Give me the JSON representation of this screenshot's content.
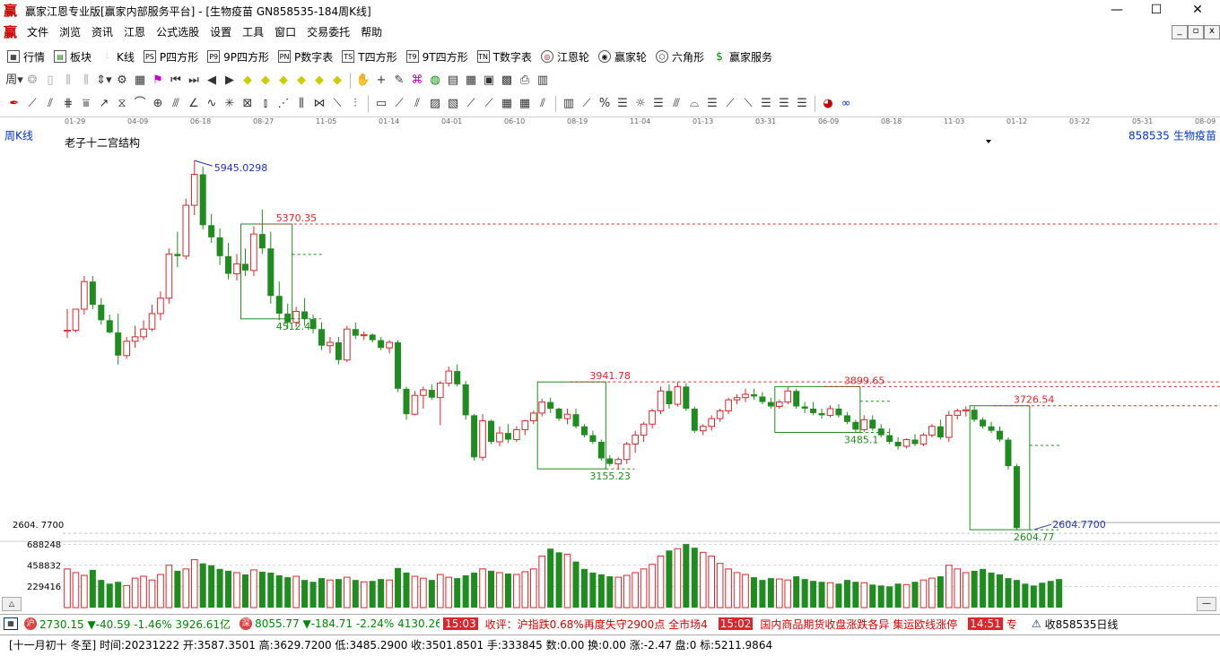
{
  "window": {
    "title": "赢家江恩专业版[赢家内部服务平台] - [生物疫苗   GN858535-184周K线]",
    "minimize_label": "—",
    "maximize_label": "☐",
    "close_label": "✕"
  },
  "app_logo": "赢",
  "menu": [
    "文件",
    "浏览",
    "资讯",
    "江恩",
    "公式选股",
    "设置",
    "工具",
    "窗口",
    "交易委托",
    "帮助"
  ],
  "toolbar_main": [
    {
      "label": "行情",
      "icon": "grid-icon"
    },
    {
      "label": "板块",
      "icon": "blocks-icon"
    },
    {
      "label": "K线",
      "icon": "kline-icon"
    },
    {
      "label": "P四方形",
      "icon": "ps-icon",
      "badge": "PS"
    },
    {
      "label": "9P四方形",
      "icon": "p9-icon",
      "badge": "P9"
    },
    {
      "label": "P数字表",
      "icon": "pn-icon",
      "badge": "PN"
    },
    {
      "label": "T四方形",
      "icon": "ts-icon",
      "badge": "TS"
    },
    {
      "label": "9T四方形",
      "icon": "t9-icon",
      "badge": "T9"
    },
    {
      "label": "T数字表",
      "icon": "tn-icon",
      "badge": "TN"
    },
    {
      "label": "江恩轮",
      "icon": "gann-wheel-icon"
    },
    {
      "label": "赢家轮",
      "icon": "winner-wheel-icon"
    },
    {
      "label": "六角形",
      "icon": "hexagon-icon"
    },
    {
      "label": "赢家服务",
      "icon": "dollar-icon"
    }
  ],
  "chart": {
    "period_label": "周K线",
    "indicator_name": "老子十二宫结构",
    "code": "858535",
    "name": "生物疫苗",
    "price_axis_label": "2604. 7700",
    "volume_ticks": [
      "688248",
      "458832",
      "229416"
    ],
    "time_ticks": [
      "01-29",
      "04-09",
      "06-18",
      "08-27",
      "11-05",
      "01-14",
      "04-01",
      "06-10",
      "08-19",
      "11-04",
      "01-13",
      "03-31",
      "06-09",
      "08-18",
      "11-03",
      "01-12",
      "03-22",
      "05-31",
      "08-09"
    ],
    "annotations": {
      "high": "5945.0298",
      "box1_top": "5370.35",
      "box1_bottom": "4512.4",
      "box2_top": "3941.78",
      "box2_bottom": "3155.23",
      "box3_top": "3899.65",
      "box3_bottom": "3485.1",
      "box4_top": "3726.54",
      "box4_bottom": "2604.77",
      "low": "2604.7700"
    },
    "colors": {
      "up": "#e0242b",
      "down": "#1e8c1e",
      "box": "#1e8c1e",
      "dash_red": "#e0242b",
      "blue": "#2030c0"
    }
  },
  "chart_data": {
    "type": "candlestick",
    "period": "weekly",
    "ohlc": [
      [
        4400,
        4600,
        4340,
        4410
      ],
      [
        4410,
        4600,
        4390,
        4600
      ],
      [
        4600,
        4900,
        4550,
        4850
      ],
      [
        4850,
        4900,
        4600,
        4640
      ],
      [
        4640,
        4700,
        4460,
        4500
      ],
      [
        4500,
        4550,
        4380,
        4390
      ],
      [
        4390,
        4560,
        4100,
        4180
      ],
      [
        4180,
        4350,
        4150,
        4310
      ],
      [
        4310,
        4450,
        4250,
        4350
      ],
      [
        4350,
        4500,
        4320,
        4420
      ],
      [
        4420,
        4640,
        4400,
        4560
      ],
      [
        4560,
        4760,
        4500,
        4700
      ],
      [
        4700,
        5150,
        4650,
        5100
      ],
      [
        5100,
        5300,
        4980,
        5080
      ],
      [
        5080,
        5600,
        5050,
        5540
      ],
      [
        5540,
        5945,
        5450,
        5820
      ],
      [
        5820,
        5890,
        5320,
        5360
      ],
      [
        5360,
        5460,
        5200,
        5250
      ],
      [
        5250,
        5330,
        5000,
        5080
      ],
      [
        5080,
        5200,
        4870,
        4920
      ],
      [
        4920,
        5100,
        4860,
        5010
      ],
      [
        5010,
        5150,
        4900,
        4950
      ],
      [
        4950,
        5350,
        4900,
        5280
      ],
      [
        5280,
        5500,
        5100,
        5150
      ],
      [
        5150,
        5300,
        4650,
        4720
      ],
      [
        4720,
        4850,
        4500,
        4560
      ],
      [
        4560,
        4650,
        4420,
        4480
      ],
      [
        4480,
        4620,
        4440,
        4580
      ],
      [
        4580,
        4700,
        4450,
        4510
      ],
      [
        4510,
        4550,
        4380,
        4420
      ],
      [
        4420,
        4480,
        4230,
        4270
      ],
      [
        4270,
        4350,
        4200,
        4300
      ],
      [
        4300,
        4350,
        4100,
        4140
      ],
      [
        4140,
        4450,
        4120,
        4420
      ],
      [
        4420,
        4480,
        4330,
        4360
      ],
      [
        4360,
        4400,
        4320,
        4370
      ],
      [
        4370,
        4380,
        4300,
        4320
      ],
      [
        4320,
        4350,
        4230,
        4250
      ],
      [
        4250,
        4320,
        4200,
        4300
      ],
      [
        4300,
        4320,
        3850,
        3880
      ],
      [
        3880,
        3900,
        3600,
        3650
      ],
      [
        3650,
        3860,
        3640,
        3820
      ],
      [
        3820,
        3900,
        3700,
        3870
      ],
      [
        3870,
        3920,
        3780,
        3800
      ],
      [
        3800,
        3950,
        3550,
        3930
      ],
      [
        3930,
        4080,
        3900,
        4040
      ],
      [
        4040,
        4100,
        3900,
        3920
      ],
      [
        3920,
        3950,
        3600,
        3640
      ],
      [
        3640,
        3650,
        3230,
        3260
      ],
      [
        3260,
        3650,
        3230,
        3590
      ],
      [
        3590,
        3600,
        3380,
        3400
      ],
      [
        3400,
        3540,
        3360,
        3480
      ],
      [
        3480,
        3560,
        3390,
        3420
      ],
      [
        3420,
        3540,
        3400,
        3510
      ],
      [
        3510,
        3600,
        3460,
        3590
      ],
      [
        3590,
        3680,
        3560,
        3660
      ],
      [
        3660,
        3790,
        3630,
        3760
      ],
      [
        3760,
        3800,
        3660,
        3700
      ],
      [
        3700,
        3710,
        3590,
        3610
      ],
      [
        3610,
        3700,
        3560,
        3650
      ],
      [
        3650,
        3700,
        3520,
        3540
      ],
      [
        3540,
        3560,
        3440,
        3460
      ],
      [
        3460,
        3500,
        3380,
        3400
      ],
      [
        3400,
        3420,
        3230,
        3250
      ],
      [
        3250,
        3280,
        3180,
        3200
      ],
      [
        3200,
        3260,
        3155,
        3240
      ],
      [
        3240,
        3400,
        3200,
        3380
      ],
      [
        3380,
        3500,
        3300,
        3460
      ],
      [
        3460,
        3580,
        3400,
        3560
      ],
      [
        3560,
        3700,
        3520,
        3680
      ],
      [
        3680,
        3900,
        3650,
        3860
      ],
      [
        3860,
        3920,
        3700,
        3740
      ],
      [
        3740,
        3940,
        3720,
        3900
      ],
      [
        3900,
        3930,
        3680,
        3700
      ],
      [
        3700,
        3720,
        3480,
        3500
      ],
      [
        3500,
        3560,
        3460,
        3540
      ],
      [
        3540,
        3640,
        3500,
        3610
      ],
      [
        3610,
        3700,
        3580,
        3680
      ],
      [
        3680,
        3800,
        3650,
        3780
      ],
      [
        3780,
        3830,
        3740,
        3800
      ],
      [
        3800,
        3880,
        3760,
        3830
      ],
      [
        3830,
        3880,
        3780,
        3810
      ],
      [
        3810,
        3850,
        3740,
        3760
      ],
      [
        3760,
        3800,
        3700,
        3720
      ],
      [
        3720,
        3780,
        3700,
        3760
      ],
      [
        3760,
        3900,
        3740,
        3860
      ],
      [
        3860,
        3880,
        3700,
        3720
      ],
      [
        3720,
        3760,
        3660,
        3700
      ],
      [
        3700,
        3760,
        3640,
        3660
      ],
      [
        3660,
        3700,
        3610,
        3640
      ],
      [
        3640,
        3730,
        3620,
        3700
      ],
      [
        3700,
        3740,
        3620,
        3640
      ],
      [
        3640,
        3670,
        3560,
        3580
      ],
      [
        3580,
        3600,
        3490,
        3510
      ],
      [
        3510,
        3640,
        3490,
        3600
      ],
      [
        3600,
        3640,
        3500,
        3520
      ],
      [
        3520,
        3560,
        3440,
        3460
      ],
      [
        3460,
        3520,
        3380,
        3400
      ],
      [
        3400,
        3440,
        3330,
        3360
      ],
      [
        3360,
        3430,
        3340,
        3420
      ],
      [
        3420,
        3470,
        3360,
        3380
      ],
      [
        3380,
        3480,
        3360,
        3460
      ],
      [
        3460,
        3560,
        3440,
        3540
      ],
      [
        3540,
        3600,
        3420,
        3440
      ],
      [
        3440,
        3680,
        3400,
        3640
      ],
      [
        3640,
        3700,
        3600,
        3680
      ],
      [
        3680,
        3720,
        3630,
        3690
      ],
      [
        3690,
        3720,
        3580,
        3600
      ],
      [
        3600,
        3620,
        3520,
        3540
      ],
      [
        3540,
        3580,
        3480,
        3500
      ],
      [
        3500,
        3540,
        3400,
        3420
      ],
      [
        3420,
        3440,
        3150,
        3180
      ],
      [
        3180,
        3200,
        2604.77,
        2620
      ]
    ],
    "volume": [
      420000,
      380000,
      350000,
      410000,
      300000,
      260000,
      280000,
      240000,
      320000,
      340000,
      300000,
      360000,
      460000,
      400000,
      420000,
      520000,
      480000,
      460000,
      420000,
      400000,
      380000,
      360000,
      410000,
      390000,
      380000,
      350000,
      330000,
      340000,
      300000,
      280000,
      320000,
      300000,
      310000,
      330000,
      300000,
      280000,
      290000,
      310000,
      300000,
      430000,
      380000,
      340000,
      320000,
      300000,
      360000,
      330000,
      320000,
      350000,
      380000,
      420000,
      400000,
      380000,
      370000,
      360000,
      390000,
      420000,
      560000,
      640000,
      600000,
      580000,
      500000,
      420000,
      380000,
      360000,
      340000,
      330000,
      350000,
      380000,
      420000,
      470000,
      560000,
      620000,
      640000,
      690000,
      650000,
      600000,
      560000,
      480000,
      420000,
      380000,
      360000,
      330000,
      300000,
      320000,
      310000,
      300000,
      340000,
      310000,
      290000,
      280000,
      270000,
      260000,
      300000,
      280000,
      270000,
      250000,
      240000,
      230000,
      260000,
      250000,
      280000,
      300000,
      320000,
      340000,
      460000,
      420000,
      380000,
      400000,
      420000,
      380000,
      360000,
      320000,
      300000,
      260000,
      240000,
      270000,
      290000,
      310000
    ],
    "ylim": [
      2500,
      6100
    ]
  },
  "status": {
    "sh_label": "沪",
    "sh_text": "2730.15 ▼-40.59 -1.46% 3926.61亿",
    "sz_label": "深",
    "sz_text": "8055.77 ▼-184.71 -2.24% 4130.26",
    "news1_time": "15:03",
    "news1_text": "收评：沪指跌0.68%再度失守2900点 全市场4",
    "news2_time": "15:02",
    "news2_text": "国内商品期货收盘涨跌各异 集运欧线涨停",
    "news3_time": "14:51",
    "news3_tail": "专",
    "right_text": "收858535日线"
  },
  "status2": {
    "text": "[十一月初十 冬至] 时间:20231222 开:3587.3501 高:3629.7200 低:3485.2900 收:3501.8501 手:333845 数:0.00 换:0.00 涨:-2.47 盘:0 标:5211.9864"
  }
}
